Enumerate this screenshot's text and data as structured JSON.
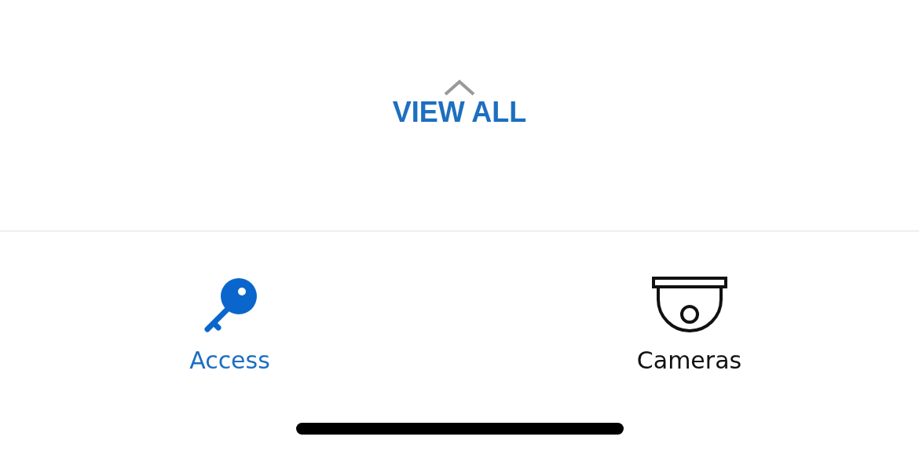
{
  "view_all": {
    "label": "VIEW ALL"
  },
  "tabs": [
    {
      "label": "Access",
      "kind": "key",
      "selected": true
    },
    {
      "label": "Cameras",
      "kind": "camera",
      "selected": false
    }
  ]
}
